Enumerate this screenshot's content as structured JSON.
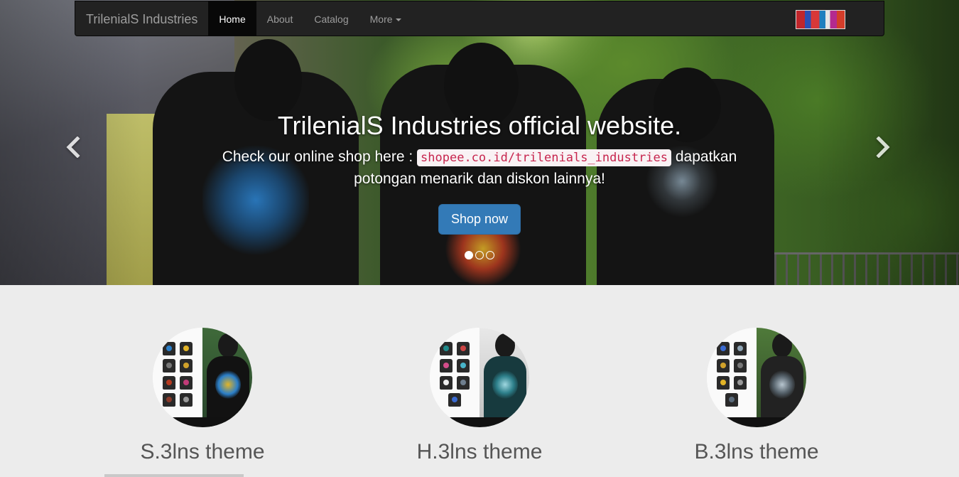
{
  "navbar": {
    "brand": "TrilenialS Industries",
    "items": [
      {
        "label": "Home",
        "active": true
      },
      {
        "label": "About",
        "active": false
      },
      {
        "label": "Catalog",
        "active": false
      },
      {
        "label": "More",
        "active": false,
        "dropdown": true
      }
    ],
    "logo_icon": "trilenials-logo"
  },
  "carousel": {
    "heading": "TrilenialS Industries official website.",
    "text_before": "Check our online shop here :",
    "shop_link": "shopee.co.id/trilenials_industries",
    "text_after": "dapatkan potongan menarik dan diskon lainnya!",
    "button_label": "Shop now",
    "slide_count": 3,
    "active_slide": 1,
    "prev_icon": "chevron-left-icon",
    "next_icon": "chevron-right-icon"
  },
  "themes": [
    {
      "title": "S.3lns theme",
      "accent": "#2b7fc9"
    },
    {
      "title": "H.3lns theme",
      "accent": "#1f8a8a"
    },
    {
      "title": "B.3lns theme",
      "accent": "#8fa5b5"
    }
  ],
  "colors": {
    "navbar_bg": "#222222",
    "primary_button": "#337ab7",
    "section_bg": "#ececec",
    "code_text": "#c7254e"
  }
}
